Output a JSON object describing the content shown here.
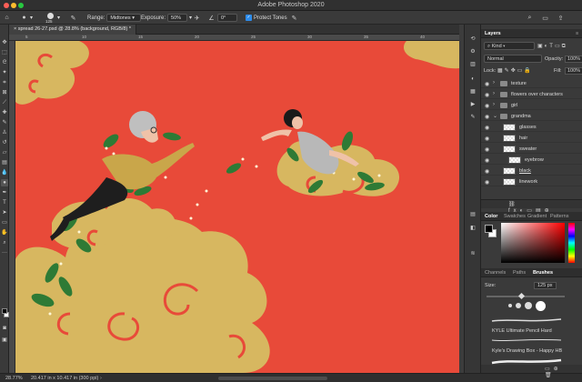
{
  "app": {
    "title": "Adobe Photoshop 2020"
  },
  "options": {
    "brush_size": "125",
    "range_label": "Range:",
    "range_value": "Midtones",
    "exposure_label": "Exposure:",
    "exposure_value": "50%",
    "angle_value": "0°",
    "protect_tones": "Protect Tones"
  },
  "document": {
    "tab": "spread 26-27.psd @ 28.8% (background, RGB/8) *"
  },
  "ruler": {
    "ticks": [
      "5",
      "10",
      "15",
      "20",
      "25",
      "30",
      "35",
      "40"
    ]
  },
  "status": {
    "zoom": "28.77%",
    "size": "20.417 in x 10.417 in (300 ppi)"
  },
  "layers_panel": {
    "tab": "Layers",
    "kind": "Kind",
    "blend_mode": "Normal",
    "opacity_label": "Opacity:",
    "opacity_value": "100%",
    "lock_label": "Lock:",
    "fill_label": "Fill:",
    "fill_value": "100%",
    "layers": [
      {
        "name": "texture",
        "type": "group"
      },
      {
        "name": "flowers over characters",
        "type": "group"
      },
      {
        "name": "girl",
        "type": "group"
      },
      {
        "name": "grandma",
        "type": "group-open"
      },
      {
        "name": "glasses",
        "type": "layer"
      },
      {
        "name": "hair",
        "type": "layer"
      },
      {
        "name": "sweater",
        "type": "layer"
      },
      {
        "name": "eyebrow",
        "type": "layer"
      },
      {
        "name": "black",
        "type": "layer"
      },
      {
        "name": "linework",
        "type": "layer"
      }
    ]
  },
  "color_panel": {
    "tabs": [
      "Color",
      "Swatches",
      "Gradient",
      "Patterns"
    ]
  },
  "brushes_panel": {
    "tabs": [
      "Channels",
      "Paths",
      "Brushes"
    ],
    "size_label": "Size:",
    "size_value": "125 px",
    "brushes": [
      "KYLE Ultimate Pencil Hard",
      "Kyle's Drawing Box - Happy HB"
    ]
  },
  "colors": {
    "canvas_bg": "#e84a39",
    "cloud": "#d7b760",
    "leaf": "#2e7a35",
    "foreground": "#000000",
    "background": "#ffffff"
  }
}
